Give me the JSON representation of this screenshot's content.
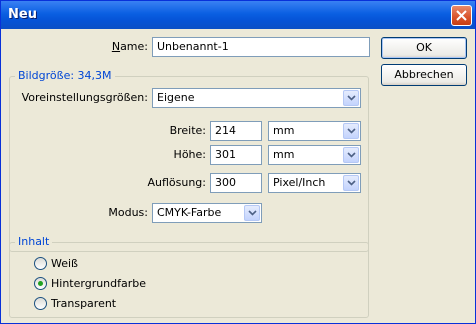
{
  "window": {
    "title": "Neu"
  },
  "name": {
    "label": "Name:",
    "value": "Unbenannt-1"
  },
  "buttons": {
    "ok": "OK",
    "cancel": "Abbrechen"
  },
  "image_size": {
    "legend": "Bildgröße: 34,3M",
    "preset": {
      "label": "Voreinstellungsgrößen:",
      "value": "Eigene"
    },
    "width": {
      "label": "Breite:",
      "value": "214",
      "unit": "mm"
    },
    "height": {
      "label": "Höhe:",
      "value": "301",
      "unit": "mm"
    },
    "resolution": {
      "label": "Auflösung:",
      "value": "300",
      "unit": "Pixel/Inch"
    },
    "mode": {
      "label": "Modus:",
      "value": "CMYK-Farbe"
    }
  },
  "content": {
    "legend": "Inhalt",
    "options": [
      {
        "label": "Weiß",
        "selected": false
      },
      {
        "label": "Hintergrundfarbe",
        "selected": true
      },
      {
        "label": "Transparent",
        "selected": false
      }
    ]
  },
  "colors": {
    "titlebar": "#0553d6",
    "legend": "#0046d5",
    "dialog_bg": "#ece9d8",
    "radio_dot": "#21a121"
  }
}
